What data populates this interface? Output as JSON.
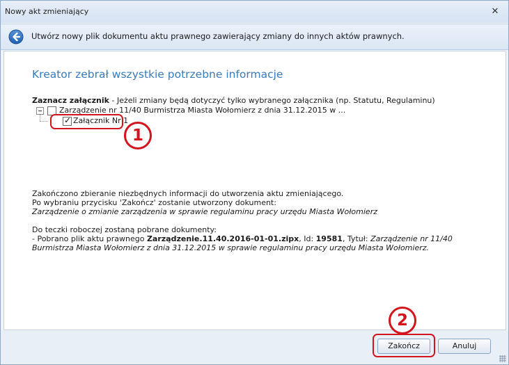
{
  "window": {
    "title": "Nowy akt zmieniający"
  },
  "header": {
    "text": "Utwórz nowy plik dokumentu aktu prawnego zawierający zmiany do innych aktów prawnych."
  },
  "content": {
    "heading": "Kreator zebrał wszystkie potrzebne informacje",
    "select_label": "Zaznacz załącznik",
    "select_hint": " - Jeżeli zmiany będą dotyczyć tylko wybranego załącznika (np. Statutu, Regulaminu)",
    "tree": {
      "root_label": "Zarządzenie nr 11/40 Burmistrza Miasta Wołomierz  z dnia 31.12.2015 w ...",
      "root_checked": false,
      "child_label": "Załącznik Nr 1",
      "child_checked": true
    },
    "summary": {
      "line1": "Zakończono zbieranie niezbędnych informacji do utworzenia aktu zmieniającego.",
      "line2": "Po wybraniu przycisku 'Zakończ' zostanie utworzony dokument:",
      "line3": "Zarządzenie o zmianie zarządzenia w sprawie regulaminu pracy urzędu Miasta Wołomierz"
    },
    "download": {
      "intro": "Do teczki roboczej zostaną pobrane dokumenty:",
      "prefix": " - Pobrano plik aktu prawnego ",
      "file": "Zarządzenie.11.40.2016-01-01.zipx",
      "id_label": ", Id: ",
      "id_value": "19581",
      "title_label": ", Tytuł: ",
      "title_value": "Zarządzenie nr 11/40 Burmistrza Miasta Wołomierz  z dnia 31.12.2015 w sprawie regulaminu pracy urzędu Miasta Wołomierz."
    }
  },
  "markers": {
    "one": "1",
    "two": "2"
  },
  "buttons": {
    "finish": "Zakończ",
    "cancel": "Anuluj"
  },
  "colors": {
    "heading": "#3a7bb7",
    "highlight": "#d2141c"
  }
}
